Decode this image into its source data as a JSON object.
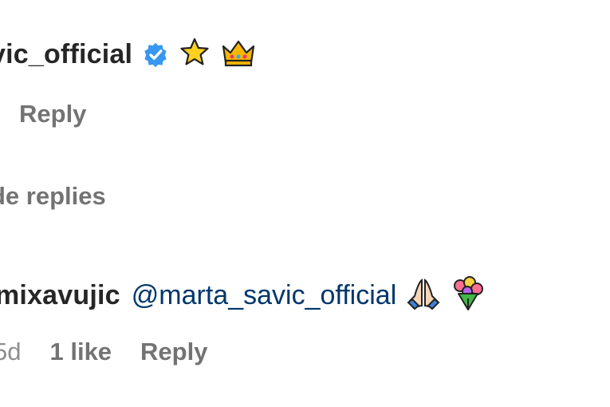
{
  "comment_top": {
    "username": "vic_official",
    "verified_icon": "verified-badge-icon",
    "emojis": [
      "star",
      "crown"
    ],
    "reply_label": "Reply"
  },
  "thread": {
    "hide_replies_label": "de replies"
  },
  "comment_reply": {
    "username": "mixavujic",
    "mention": "@marta_savic_official",
    "emojis": [
      "folded-hands",
      "bouquet"
    ],
    "time": "5d",
    "likes": "1 like",
    "reply_label": "Reply"
  },
  "colors": {
    "text": "#262626",
    "muted": "#8e8e8e",
    "link": "#00376b",
    "verified_blue": "#3897f0"
  }
}
